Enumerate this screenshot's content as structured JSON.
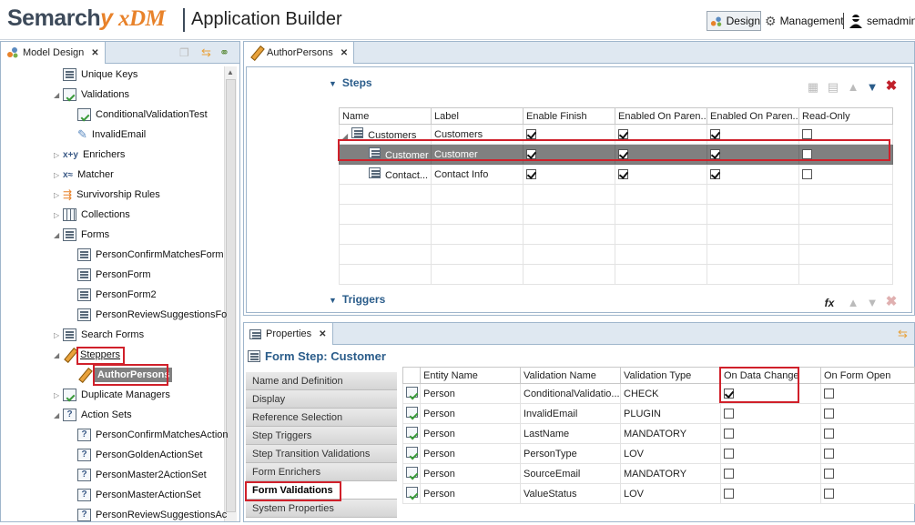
{
  "header": {
    "brand_main": "Semarch",
    "brand_y": "y",
    "brand_xdm": "xDM",
    "app_title": "Application Builder",
    "design_label": "Design",
    "management_label": "Management",
    "user_label": "semadmin"
  },
  "left_panel": {
    "tab_label": "Model Design",
    "tree": [
      {
        "label": "Unique Keys",
        "icon": "form-icon"
      },
      {
        "label": "Validations",
        "icon": "check-icon",
        "expanded": true
      },
      {
        "label": "ConditionalValidationTest",
        "icon": "check-icon"
      },
      {
        "label": "InvalidEmail",
        "icon": "plugin-icon"
      },
      {
        "label": "Enrichers",
        "icon": "enricher-icon"
      },
      {
        "label": "Matcher",
        "icon": "matcher-icon"
      },
      {
        "label": "Survivorship Rules",
        "icon": "survivorship-icon"
      },
      {
        "label": "Collections",
        "icon": "collection-icon"
      },
      {
        "label": "Forms",
        "icon": "form-icon",
        "expanded": true
      },
      {
        "label": "PersonConfirmMatchesForm",
        "icon": "form-icon"
      },
      {
        "label": "PersonForm",
        "icon": "form-icon"
      },
      {
        "label": "PersonForm2",
        "icon": "form-icon"
      },
      {
        "label": "PersonReviewSuggestionsFo",
        "icon": "form-icon"
      },
      {
        "label": "Search Forms",
        "icon": "search-form-icon"
      },
      {
        "label": "Steppers",
        "icon": "pencil-icon",
        "expanded": true
      },
      {
        "label": "AuthorPersons",
        "icon": "pencil-icon",
        "selected": true
      },
      {
        "label": "Duplicate Managers",
        "icon": "duplicate-icon"
      },
      {
        "label": "Action Sets",
        "icon": "action-icon",
        "expanded": true
      },
      {
        "label": "PersonConfirmMatchesAction",
        "icon": "action-icon"
      },
      {
        "label": "PersonGoldenActionSet",
        "icon": "action-icon"
      },
      {
        "label": "PersonMaster2ActionSet",
        "icon": "action-icon"
      },
      {
        "label": "PersonMasterActionSet",
        "icon": "action-icon"
      },
      {
        "label": "PersonReviewSuggestionsAc",
        "icon": "action-icon"
      }
    ]
  },
  "editor": {
    "tab_label": "AuthorPersons",
    "steps_title": "Steps",
    "triggers_title": "Triggers",
    "steps_columns": [
      "Name",
      "Label",
      "Enable Finish",
      "Enabled On Paren...",
      "Enabled On Paren...",
      "Read-Only"
    ],
    "steps_rows": [
      {
        "name": "Customers",
        "label": "Customers",
        "enable_finish": true,
        "enabled_on_parent_1": true,
        "enabled_on_parent_2": true,
        "read_only": false
      },
      {
        "name": "Customer",
        "label": "Customer",
        "enable_finish": true,
        "enabled_on_parent_1": true,
        "enabled_on_parent_2": true,
        "read_only": false,
        "selected": true
      },
      {
        "name": "Contact...",
        "label": "Contact Info",
        "enable_finish": true,
        "enabled_on_parent_1": true,
        "enabled_on_parent_2": true,
        "read_only": false
      }
    ]
  },
  "properties": {
    "tab_label": "Properties",
    "title": "Form Step: Customer",
    "nav": [
      "Name and Definition",
      "Display",
      "Reference Selection",
      "Step Triggers",
      "Step Transition Validations",
      "Form Enrichers",
      "Form Validations",
      "System Properties"
    ],
    "active_nav": "Form Validations",
    "columns": [
      "Entity Name",
      "Validation Name",
      "Validation Type",
      "On Data Change",
      "On Form Open"
    ],
    "rows": [
      {
        "entity": "Person",
        "validation": "ConditionalValidatio...",
        "type": "CHECK",
        "on_data_change": true,
        "on_form_open": false
      },
      {
        "entity": "Person",
        "validation": "InvalidEmail",
        "type": "PLUGIN",
        "on_data_change": false,
        "on_form_open": false
      },
      {
        "entity": "Person",
        "validation": "LastName",
        "type": "MANDATORY",
        "on_data_change": false,
        "on_form_open": false
      },
      {
        "entity": "Person",
        "validation": "PersonType",
        "type": "LOV",
        "on_data_change": false,
        "on_form_open": false
      },
      {
        "entity": "Person",
        "validation": "SourceEmail",
        "type": "MANDATORY",
        "on_data_change": false,
        "on_form_open": false
      },
      {
        "entity": "Person",
        "validation": "ValueStatus",
        "type": "LOV",
        "on_data_change": false,
        "on_form_open": false
      }
    ]
  },
  "colors": {
    "accent_blue": "#2a5c8a",
    "highlight_red": "#d0202a",
    "brand_orange": "#e8822a"
  }
}
